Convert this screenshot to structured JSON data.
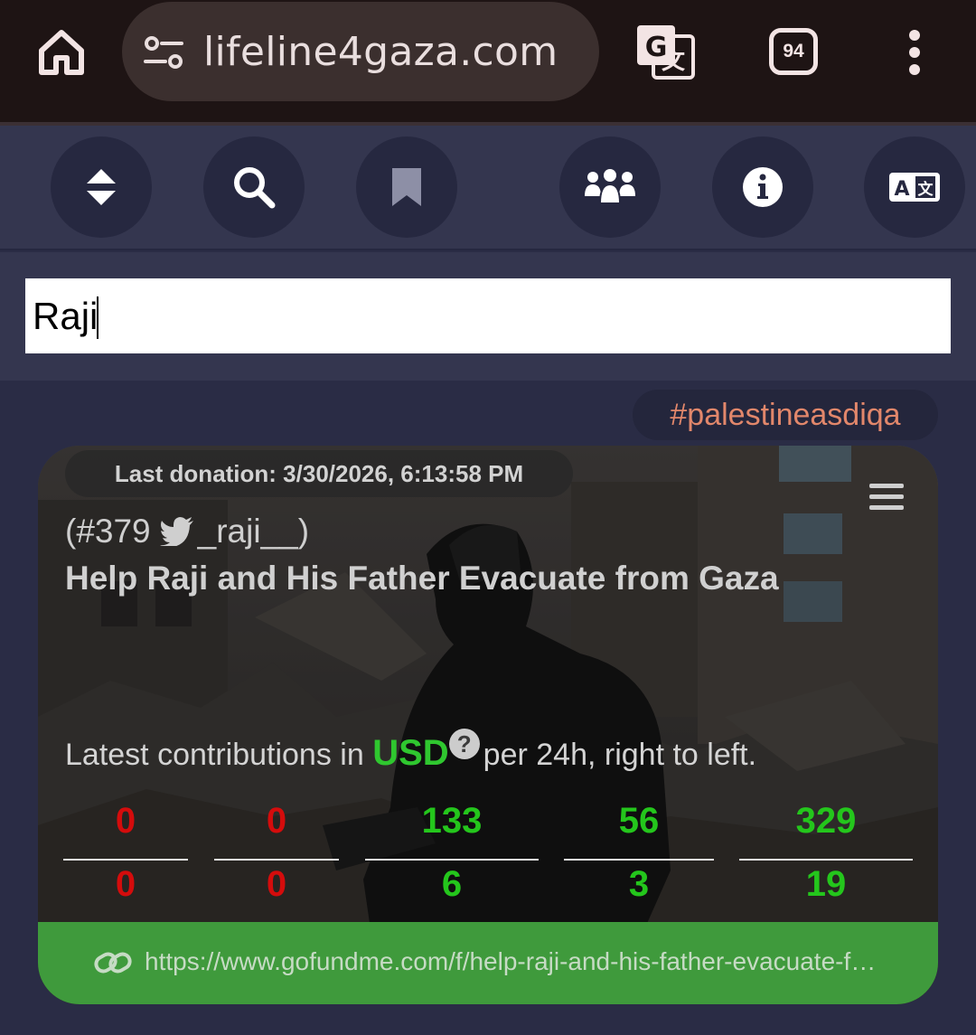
{
  "browser": {
    "url": "lifeline4gaza.com",
    "tab_count": "94"
  },
  "search": {
    "value": "Raji"
  },
  "tag": "#palestineasdiqa",
  "card": {
    "last_donation": "Last donation:  3/30/2026, 6:13:58 PM",
    "handle_number": "(#379",
    "handle_name": "_raji__)",
    "title": "Help Raji and His Father Evacuate from Gaza",
    "contrib_prefix": "Latest contributions in",
    "currency": "USD",
    "help_glyph": "?",
    "contrib_suffix": "per 24h, right to left.",
    "amounts": [
      "0",
      "0",
      "133",
      "56",
      "329"
    ],
    "counts": [
      "0",
      "0",
      "6",
      "3",
      "19"
    ],
    "link": "https://www.gofundme.com/f/help-raji-and-his-father-evacuate-from-gaza"
  },
  "colors": {
    "zero": "#d40c0c",
    "positive": "#24c61c",
    "link_bar": "#3f9a3c"
  }
}
